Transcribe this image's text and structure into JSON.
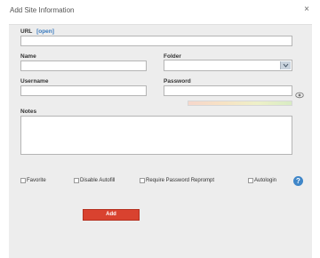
{
  "dialog": {
    "title": "Add Site Information",
    "close_glyph": "×"
  },
  "form": {
    "url_label": "URL",
    "url_open_link": "[open]",
    "url_value": "",
    "name_label": "Name",
    "name_value": "",
    "folder_label": "Folder",
    "folder_value": "",
    "username_label": "Username",
    "username_value": "",
    "password_label": "Password",
    "password_value": "",
    "notes_label": "Notes",
    "notes_value": ""
  },
  "options": {
    "favorite": "Favorite",
    "disable_autofill": "Disable Autofill",
    "require_reprompt": "Require Password Reprompt",
    "autologin": "Autologin",
    "help_glyph": "?"
  },
  "actions": {
    "add_label": "Add"
  },
  "colors": {
    "add_button": "#d9422f",
    "link": "#3b7bbf",
    "help": "#3f86c8"
  },
  "icons": {
    "close": "close-icon",
    "eye": "eye-icon",
    "dropdown": "chevron-down-icon",
    "help": "help-icon"
  }
}
